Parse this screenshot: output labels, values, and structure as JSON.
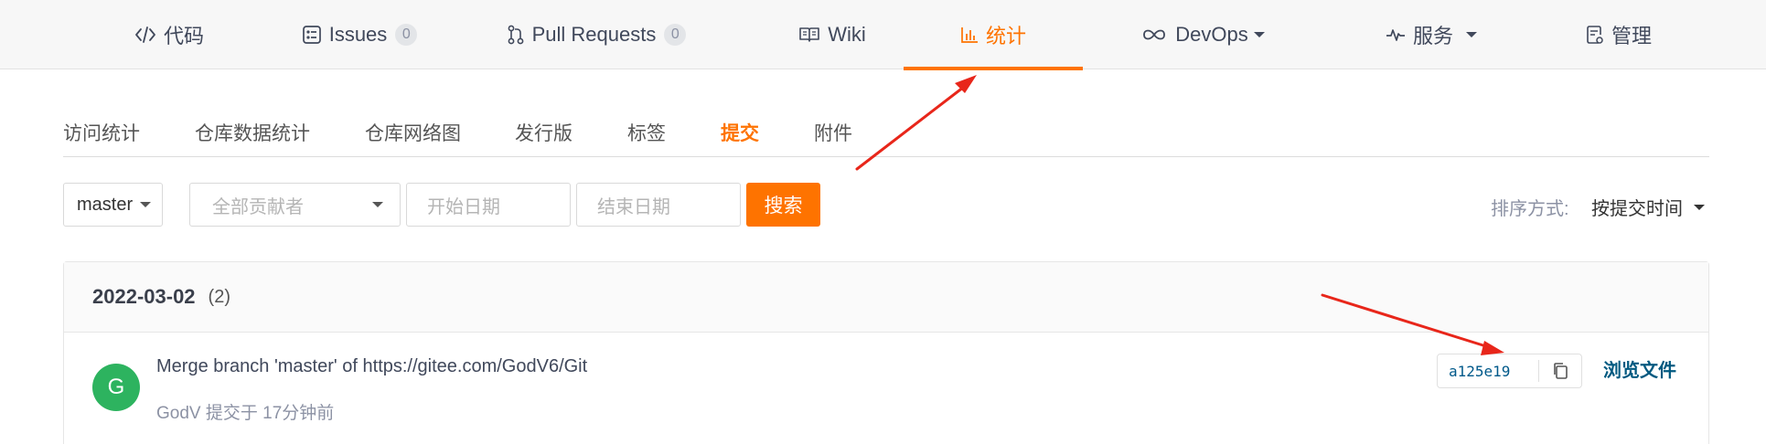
{
  "nav": {
    "code": "代码",
    "issues": "Issues",
    "issues_count": "0",
    "pull_requests": "Pull Requests",
    "pull_requests_count": "0",
    "wiki": "Wiki",
    "stats": "统计",
    "devops": "DevOps",
    "services": "服务",
    "manage": "管理",
    "active_color": "#fe7300"
  },
  "subtabs": [
    "访问统计",
    "仓库数据统计",
    "仓库网络图",
    "发行版",
    "标签",
    "提交",
    "附件"
  ],
  "subtab_active": "提交",
  "filters": {
    "branch": "master",
    "contributor_placeholder": "全部贡献者",
    "start_date_placeholder": "开始日期",
    "end_date_placeholder": "结束日期",
    "search_label": "搜索",
    "sort_label": "排序方式:",
    "sort_value": "按提交时间"
  },
  "commit_group": {
    "date": "2022-03-02",
    "count": "(2)",
    "commits": [
      {
        "avatar_letter": "G",
        "avatar_color": "#2db35f",
        "message": "Merge branch 'master' of https://gitee.com/GodV6/Git",
        "meta": "GodV 提交于 17分钟前",
        "sha": "a125e19",
        "browse_label": "浏览文件"
      }
    ]
  },
  "annotation_color": "#e8261a"
}
